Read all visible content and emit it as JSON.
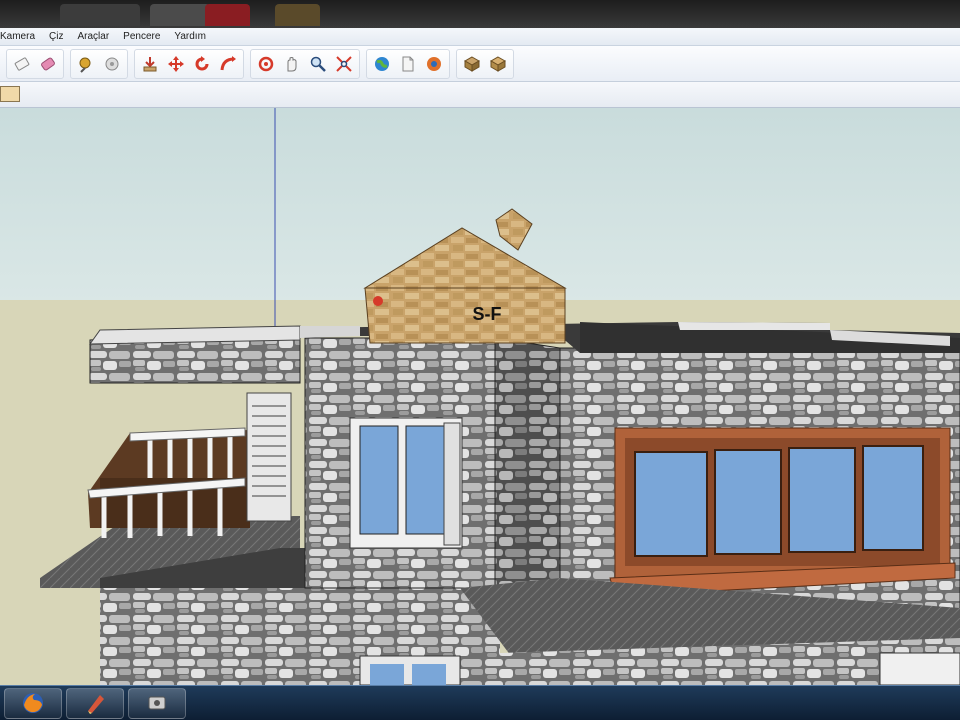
{
  "menubar": {
    "items": [
      "Kamera",
      "Çiz",
      "Araçlar",
      "Pencere",
      "Yardım"
    ]
  },
  "toolbar": {
    "groups": [
      {
        "name": "edit-tools",
        "icons": [
          "eraser-icon",
          "paint-bucket-icon"
        ]
      },
      {
        "name": "select-tools",
        "icons": [
          "tape-measure-icon",
          "component-icon"
        ]
      },
      {
        "name": "modify-tools",
        "icons": [
          "push-pull-icon",
          "move-icon",
          "rotate-icon",
          "follow-me-icon"
        ]
      },
      {
        "name": "camera-tools",
        "icons": [
          "orbit-icon",
          "pan-icon",
          "zoom-icon",
          "zoom-extents-icon"
        ]
      },
      {
        "name": "geo-tools",
        "icons": [
          "globe-icon",
          "page-icon",
          "3d-warehouse-icon"
        ]
      },
      {
        "name": "component-tools",
        "icons": [
          "get-models-icon",
          "share-model-icon"
        ]
      }
    ]
  },
  "model": {
    "label": "S-F",
    "colors": {
      "stone": "#7d7d7d",
      "wood": "#c9a36a",
      "window_frame": "#b0623a",
      "glass": "#7aa6d8",
      "roof_slab": "#3a3a3a"
    }
  },
  "taskbar": {
    "apps": [
      "firefox-icon",
      "sketchup-icon",
      "media-icon"
    ]
  },
  "colors": {
    "sky_top": "#c9dcdc",
    "ground": "#d8d6b8",
    "taskbar": "#1f3b5a"
  }
}
